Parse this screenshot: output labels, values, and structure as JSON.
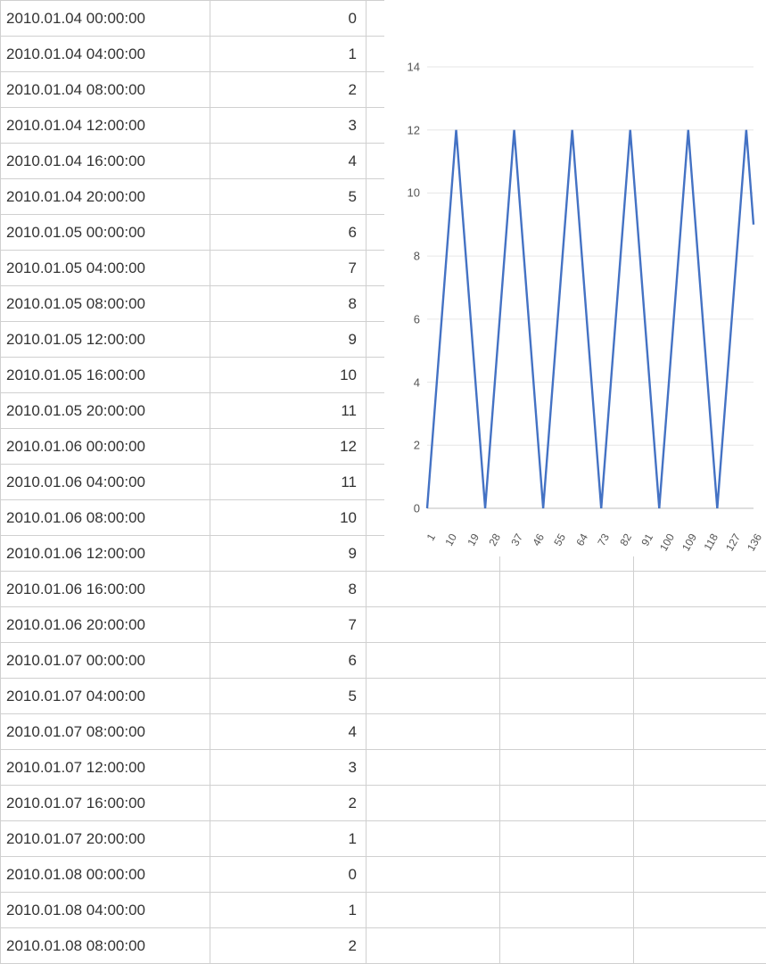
{
  "table": {
    "rows": [
      {
        "a": "2010.01.04 00:00:00",
        "b": "0"
      },
      {
        "a": "2010.01.04 04:00:00",
        "b": "1"
      },
      {
        "a": "2010.01.04 08:00:00",
        "b": "2"
      },
      {
        "a": "2010.01.04 12:00:00",
        "b": "3"
      },
      {
        "a": "2010.01.04 16:00:00",
        "b": "4"
      },
      {
        "a": "2010.01.04 20:00:00",
        "b": "5"
      },
      {
        "a": "2010.01.05 00:00:00",
        "b": "6"
      },
      {
        "a": "2010.01.05 04:00:00",
        "b": "7"
      },
      {
        "a": "2010.01.05 08:00:00",
        "b": "8"
      },
      {
        "a": "2010.01.05 12:00:00",
        "b": "9"
      },
      {
        "a": "2010.01.05 16:00:00",
        "b": "10"
      },
      {
        "a": "2010.01.05 20:00:00",
        "b": "11"
      },
      {
        "a": "2010.01.06 00:00:00",
        "b": "12"
      },
      {
        "a": "2010.01.06 04:00:00",
        "b": "11"
      },
      {
        "a": "2010.01.06 08:00:00",
        "b": "10"
      },
      {
        "a": "2010.01.06 12:00:00",
        "b": "9"
      },
      {
        "a": "2010.01.06 16:00:00",
        "b": "8"
      },
      {
        "a": "2010.01.06 20:00:00",
        "b": "7"
      },
      {
        "a": "2010.01.07 00:00:00",
        "b": "6"
      },
      {
        "a": "2010.01.07 04:00:00",
        "b": "5"
      },
      {
        "a": "2010.01.07 08:00:00",
        "b": "4"
      },
      {
        "a": "2010.01.07 12:00:00",
        "b": "3"
      },
      {
        "a": "2010.01.07 16:00:00",
        "b": "2"
      },
      {
        "a": "2010.01.07 20:00:00",
        "b": "1"
      },
      {
        "a": "2010.01.08 00:00:00",
        "b": "0"
      },
      {
        "a": "2010.01.08 04:00:00",
        "b": "1"
      },
      {
        "a": "2010.01.08 08:00:00",
        "b": "2"
      }
    ],
    "extra_columns": [
      "",
      "",
      ""
    ]
  },
  "chart_data": {
    "type": "line",
    "y_ticks": [
      0,
      2,
      4,
      6,
      8,
      10,
      12,
      14
    ],
    "ylim": [
      0,
      14
    ],
    "x_ticks": [
      1,
      10,
      19,
      28,
      37,
      46,
      55,
      64,
      73,
      82,
      91,
      100,
      109,
      118,
      127,
      136
    ],
    "xlim": [
      1,
      136
    ],
    "series_color": "#4472C4",
    "series": {
      "period": 24,
      "amplitude_max": 12,
      "amplitude_min": 0,
      "start_value": 0,
      "pattern": "triangle_wave_up_12_down_0"
    }
  }
}
